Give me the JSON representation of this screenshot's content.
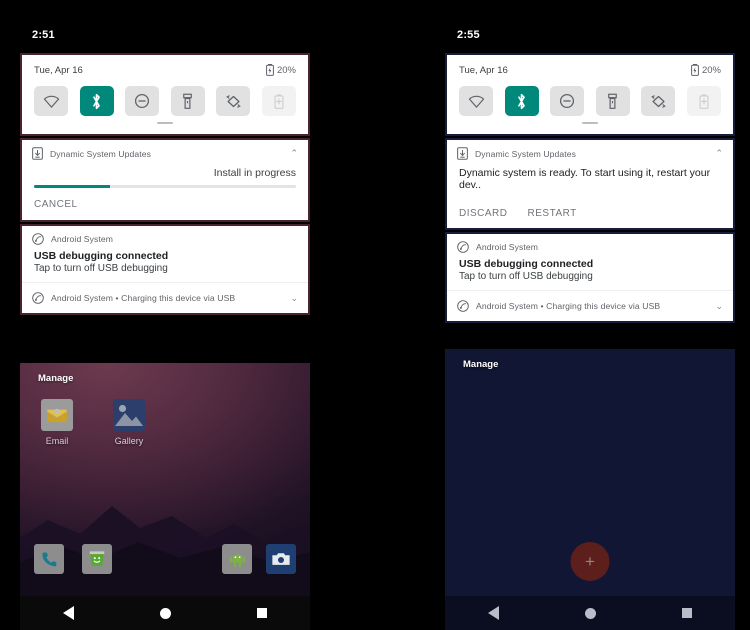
{
  "screens": [
    {
      "id": "before",
      "statusbar": {
        "clock": "2:51",
        "battery_icon": "battery-icon"
      },
      "quick_settings": {
        "date": "Tue, Apr 16",
        "battery": "20%",
        "tiles": [
          {
            "name": "wifi",
            "icon": "wifi-icon",
            "state": "off"
          },
          {
            "name": "bluetooth",
            "icon": "bluetooth-icon",
            "state": "on"
          },
          {
            "name": "do-not-disturb",
            "icon": "do-not-disturb-icon",
            "state": "off"
          },
          {
            "name": "flashlight",
            "icon": "flashlight-icon",
            "state": "off"
          },
          {
            "name": "auto-rotate",
            "icon": "auto-rotate-icon",
            "state": "off"
          },
          {
            "name": "battery-saver",
            "icon": "battery-saver-icon",
            "state": "disabled"
          }
        ]
      },
      "notifications": [
        {
          "app": "Dynamic System Updates",
          "icon": "system-update-icon",
          "chevron": "⌃",
          "status": "Install in progress",
          "progress": 29,
          "actions": [
            "CANCEL"
          ],
          "highlight": "maroon"
        },
        {
          "app": "Android System",
          "icon": "android-system-icon",
          "title": "USB debugging connected",
          "text": "Tap to turn off USB debugging",
          "highlight": "maroon"
        },
        {
          "app": "Android System • Charging this device via USB",
          "icon": "android-system-icon",
          "chevron": "⌄",
          "compact": true
        }
      ],
      "home": {
        "manage_label": "Manage",
        "apps": [
          {
            "label": "Email",
            "icon": "email-icon"
          },
          {
            "label": "Gallery",
            "icon": "gallery-icon"
          }
        ],
        "dock": [
          {
            "label": "Phone",
            "icon": "phone-icon"
          },
          {
            "label": "Messaging",
            "icon": "messaging-icon"
          },
          {
            "label": "API Demos",
            "icon": "android-robot-icon"
          },
          {
            "label": "Camera",
            "icon": "camera-icon"
          }
        ]
      },
      "navbar": {
        "back": "back-icon",
        "home": "home-icon",
        "recents": "recents-icon"
      }
    },
    {
      "id": "after",
      "statusbar": {
        "clock": "2:55",
        "battery_icon": "battery-icon"
      },
      "quick_settings": {
        "date": "Tue, Apr 16",
        "battery": "20%",
        "tiles": [
          {
            "name": "wifi",
            "icon": "wifi-icon",
            "state": "off"
          },
          {
            "name": "bluetooth",
            "icon": "bluetooth-icon",
            "state": "on"
          },
          {
            "name": "do-not-disturb",
            "icon": "do-not-disturb-icon",
            "state": "off"
          },
          {
            "name": "flashlight",
            "icon": "flashlight-icon",
            "state": "off"
          },
          {
            "name": "auto-rotate",
            "icon": "auto-rotate-icon",
            "state": "off"
          },
          {
            "name": "battery-saver",
            "icon": "battery-saver-icon",
            "state": "disabled"
          }
        ]
      },
      "notifications": [
        {
          "app": "Dynamic System Updates",
          "icon": "system-update-icon",
          "chevron": "⌃",
          "text": "Dynamic system is ready. To start using it, restart your dev..",
          "actions": [
            "DISCARD",
            "RESTART"
          ],
          "highlight": "navy"
        },
        {
          "app": "Android System",
          "icon": "android-system-icon",
          "title": "USB debugging connected",
          "text": "Tap to turn off USB debugging",
          "highlight": "navy"
        },
        {
          "app": "Android System • Charging this device via USB",
          "icon": "android-system-icon",
          "chevron": "⌄",
          "compact": true
        }
      ],
      "home": {
        "manage_label": "Manage",
        "fab": "+",
        "apps": [],
        "dock": []
      },
      "navbar": {
        "back": "back-icon",
        "home": "home-icon",
        "recents": "recents-icon"
      }
    }
  ],
  "colors": {
    "accent_teal": "#00897b",
    "highlight_maroon": "#4a2230",
    "highlight_navy": "#171c3a",
    "fab": "#5c1f1b",
    "panel_bg": "#ffffff",
    "screen_bg": "#000000"
  }
}
